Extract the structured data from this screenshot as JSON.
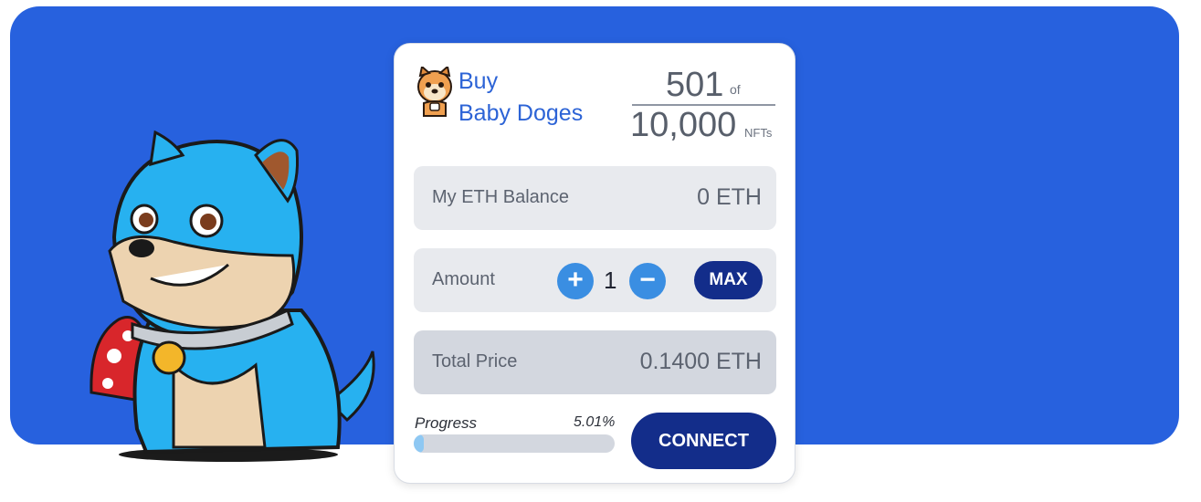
{
  "header": {
    "title_line1": "Buy",
    "title_line2": "Baby Doges",
    "minted": "501",
    "of_label": "of",
    "supply": "10,000",
    "unit_label": "NFTs"
  },
  "balance": {
    "label": "My ETH Balance",
    "value": "0 ETH"
  },
  "amount": {
    "label": "Amount",
    "quantity": "1",
    "plus_icon": "+",
    "minus_icon": "−",
    "max_label": "MAX"
  },
  "total": {
    "label": "Total Price",
    "value": "0.1400 ETH"
  },
  "progress": {
    "label": "Progress",
    "percent_text": "5.01%",
    "fraction": 0.0501
  },
  "connect_label": "CONNECT",
  "colors": {
    "background": "#2761de",
    "brand_text": "#2c63d6",
    "navy_button": "#132d8a",
    "round_button": "#3a8ee2",
    "progress_fill": "#8ec8f3"
  },
  "icons": {
    "logo": "dog-face-icon",
    "mascot": "baby-doge-mascot-illustration"
  }
}
